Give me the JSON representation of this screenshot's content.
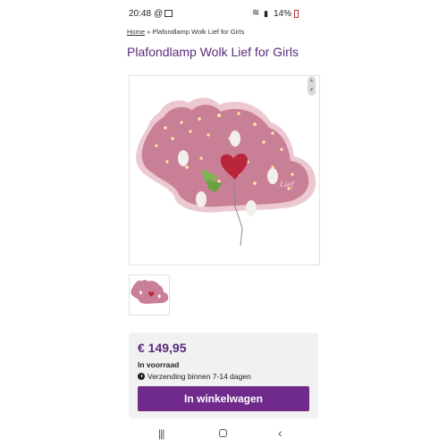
{
  "status_bar": {
    "time": "20:48",
    "battery": "14%"
  },
  "breadcrumb": {
    "home": "Home",
    "separator": "»",
    "current": "Plafondlamp Wolk Lief for Girls"
  },
  "product": {
    "title": "Plafondlamp Wolk Lief for Girls",
    "lamp_script_text": "Lief",
    "price": "€ 149,95",
    "stock_status": "In voorraad",
    "delivery": "Verzending binnen 7-14 dagen",
    "cart_button_label": "In winkelwagen"
  },
  "colors": {
    "brand_purple": "#5b2a7d",
    "button_purple": "#6f2a8c",
    "cloud_pink": "#c97f95"
  },
  "icons": {
    "status": [
      "at-icon",
      "gallery-icon",
      "wifi-icon",
      "signal-icon",
      "battery-icon"
    ],
    "nav": [
      "recent-apps-icon",
      "home-icon",
      "back-icon"
    ],
    "delivery": "clock-icon"
  }
}
